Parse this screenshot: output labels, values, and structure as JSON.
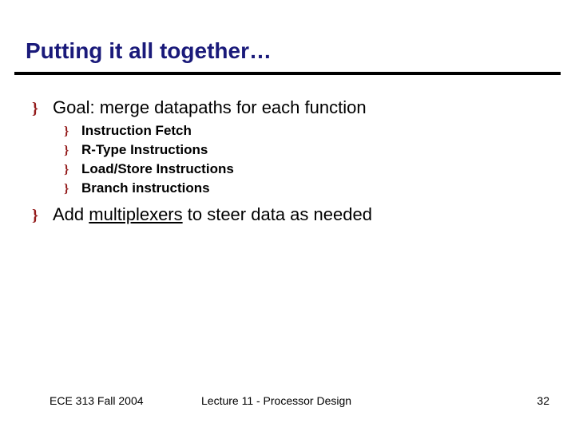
{
  "title": "Putting it all together…",
  "bullets": {
    "main1": "Goal: merge datapaths for each function",
    "sub1": "Instruction Fetch",
    "sub2": "R-Type Instructions",
    "sub3": "Load/Store Instructions",
    "sub4": "Branch instructions",
    "main2_pre": "Add ",
    "main2_u": "multiplexers",
    "main2_post": " to steer data as needed"
  },
  "bullet_glyph": "}",
  "footer": {
    "left": "ECE 313 Fall 2004",
    "center": "Lecture 11 - Processor Design",
    "right": "32"
  }
}
